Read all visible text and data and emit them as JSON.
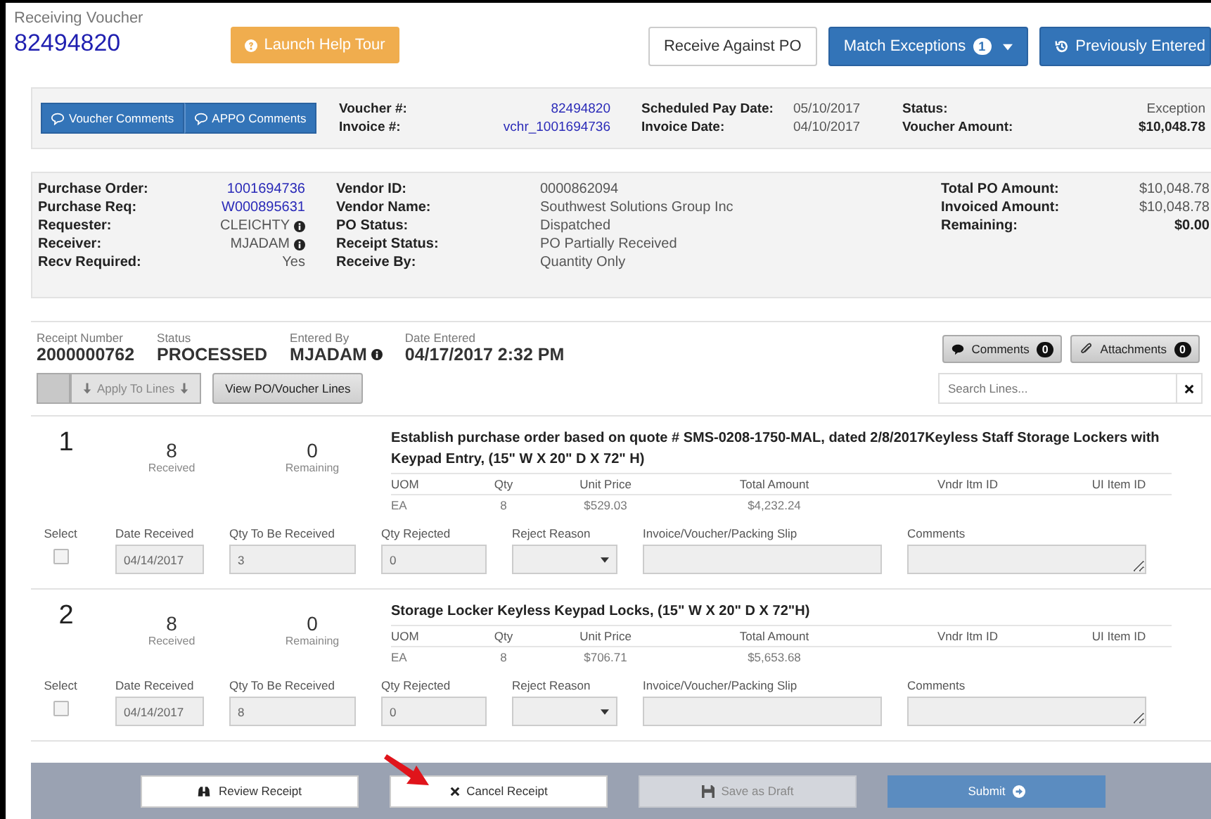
{
  "header": {
    "title": "Receiving Voucher",
    "number": "82494820",
    "help_button": "Launch Help Tour",
    "actions": [
      {
        "label": "Receive Against PO",
        "kind": "plain"
      },
      {
        "label": "Match Exceptions",
        "kind": "dropdown",
        "badge": "1"
      },
      {
        "label": "Previously Entered",
        "kind": "history"
      }
    ]
  },
  "voucher": {
    "comment_buttons": [
      "Voucher Comments",
      "APPO Comments"
    ],
    "columns": [
      [
        {
          "label": "Voucher #:",
          "value": "82494820",
          "kind": "link"
        },
        {
          "label": "Invoice #:",
          "value": "vchr_1001694736",
          "kind": "link"
        }
      ],
      [
        {
          "label": "Scheduled Pay Date:",
          "value": "05/10/2017",
          "kind": "text"
        },
        {
          "label": "Invoice Date:",
          "value": "04/10/2017",
          "kind": "text"
        }
      ],
      [
        {
          "label": "Status:",
          "value": "Exception",
          "kind": "text"
        },
        {
          "label": "Voucher Amount:",
          "value": "$10,048.78",
          "kind": "bold"
        }
      ]
    ]
  },
  "purchase": {
    "columns": [
      [
        {
          "label": "Purchase Order:",
          "value": "1001694736",
          "kind": "link"
        },
        {
          "label": "Purchase Req:",
          "value": "W000895631",
          "kind": "link"
        },
        {
          "label": "Requester:",
          "value": "CLEICHTY",
          "kind": "user"
        },
        {
          "label": "Receiver:",
          "value": "MJADAM",
          "kind": "user"
        },
        {
          "label": "Recv Required:",
          "value": "Yes",
          "kind": "text"
        }
      ],
      [
        {
          "label": "Vendor ID:",
          "value": "0000862094",
          "kind": "text"
        },
        {
          "label": "Vendor Name:",
          "value": "Southwest Solutions Group Inc",
          "kind": "text"
        },
        {
          "label": "PO Status:",
          "value": "Dispatched",
          "kind": "text"
        },
        {
          "label": "Receipt Status:",
          "value": "PO Partially Received",
          "kind": "text"
        },
        {
          "label": "Receive By:",
          "value": "Quantity Only",
          "kind": "text"
        }
      ],
      [
        {
          "label": "Total PO Amount:",
          "value": "$10,048.78",
          "kind": "text"
        },
        {
          "label": "Invoiced Amount:",
          "value": "$10,048.78",
          "kind": "text"
        },
        {
          "label": "Remaining:",
          "value": "$0.00",
          "kind": "bold"
        }
      ]
    ]
  },
  "receipt": {
    "fields": [
      {
        "label": "Receipt Number",
        "value": "2000000762",
        "kind": "text"
      },
      {
        "label": "Status",
        "value": "PROCESSED",
        "kind": "text"
      },
      {
        "label": "Entered By",
        "value": "MJADAM",
        "kind": "user"
      },
      {
        "label": "Date Entered",
        "value": "04/17/2017 2:32 PM",
        "kind": "text"
      }
    ],
    "buttons": [
      {
        "label": "Comments",
        "badge": "0",
        "kind": "comments"
      },
      {
        "label": "Attachments",
        "badge": "0",
        "kind": "attachments"
      }
    ],
    "select_all": {
      "checked": false
    },
    "apply_button": {
      "label": "Apply To Lines",
      "disabled": true
    },
    "view_button": "View PO/Voucher Lines",
    "search": {
      "placeholder": "Search Lines..."
    }
  },
  "lines": [
    {
      "number": "1",
      "received": "8",
      "received_label": "Received",
      "remaining": "0",
      "remaining_label": "Remaining",
      "description": "Establish purchase order based on quote # SMS-0208-1750-MAL, dated 2/8/2017Keyless Staff Storage Lockers with Keypad Entry, (15\" W X 20\" D X 72\" H)",
      "columns": [
        "UOM",
        "Qty",
        "Unit Price",
        "Total Amount",
        "Vndr Itm ID",
        "UI Item ID"
      ],
      "row": [
        "EA",
        "8",
        "$529.03",
        "$4,232.24"
      ],
      "form_labels": [
        "Select",
        "Date Received",
        "Qty To Be Received",
        "Qty Rejected",
        "Reject Reason",
        "Invoice/Voucher/Packing Slip",
        "Comments"
      ],
      "selected": false,
      "date_received": "04/14/2017",
      "qty_to_receive": "3",
      "qty_rejected": "0"
    },
    {
      "number": "2",
      "received": "8",
      "received_label": "Received",
      "remaining": "0",
      "remaining_label": "Remaining",
      "description": "Storage Locker Keyless Keypad Locks, (15\" W X 20\" D X 72\"H)",
      "columns": [
        "UOM",
        "Qty",
        "Unit Price",
        "Total Amount",
        "Vndr Itm ID",
        "UI Item ID"
      ],
      "row": [
        "EA",
        "8",
        "$706.71",
        "$5,653.68"
      ],
      "form_labels": [
        "Select",
        "Date Received",
        "Qty To Be Received",
        "Qty Rejected",
        "Reject Reason",
        "Invoice/Voucher/Packing Slip",
        "Comments"
      ],
      "selected": false,
      "date_received": "04/14/2017",
      "qty_to_receive": "8",
      "qty_rejected": "0"
    }
  ],
  "footer": {
    "buttons": [
      {
        "label": "Review Receipt",
        "kind": "review",
        "disabled": false
      },
      {
        "label": "Cancel Receipt",
        "kind": "cancel",
        "disabled": false
      },
      {
        "label": "Save as Draft",
        "kind": "draft",
        "disabled": true
      },
      {
        "label": "Submit",
        "kind": "submit",
        "disabled": false
      }
    ]
  }
}
